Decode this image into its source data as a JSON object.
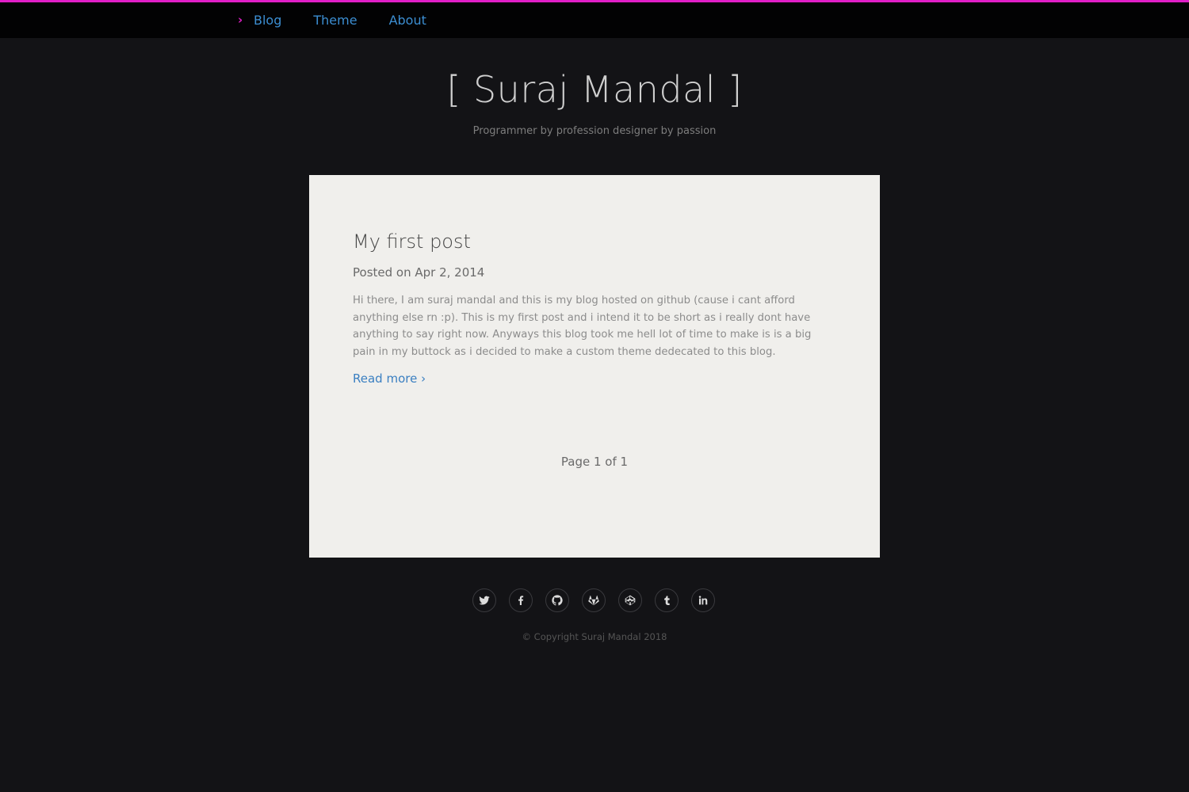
{
  "nav": {
    "items": [
      {
        "label": "Blog",
        "active": true
      },
      {
        "label": "Theme",
        "active": false
      },
      {
        "label": "About",
        "active": false
      }
    ]
  },
  "header": {
    "title": "[ Suraj Mandal ]",
    "subtitle": "Programmer by profession designer by passion"
  },
  "post": {
    "title": "My first post",
    "date": "Posted on Apr 2, 2014",
    "excerpt": "Hi there, I am suraj mandal and this is my blog hosted on github (cause i cant afford anything else rn :p). This is my first post and i intend it to be short as i really dont have anything to say right now. Anyways this blog took me hell lot of time to make is is a big pain in my buttock as i decided to make a custom theme dedecated to this blog.",
    "read_more": "Read more ›"
  },
  "pagination": {
    "text": "Page 1 of 1"
  },
  "footer": {
    "social_icons": [
      "twitter-icon",
      "facebook-icon",
      "github-icon",
      "gitlab-icon",
      "codepen-icon",
      "tumblr-icon",
      "linkedin-icon"
    ],
    "copyright": "© Copyright Suraj Mandal 2018"
  },
  "colors": {
    "accent": "#e01ec7",
    "link": "#3c8ed2",
    "background": "#131316",
    "card": "#f0efec"
  }
}
